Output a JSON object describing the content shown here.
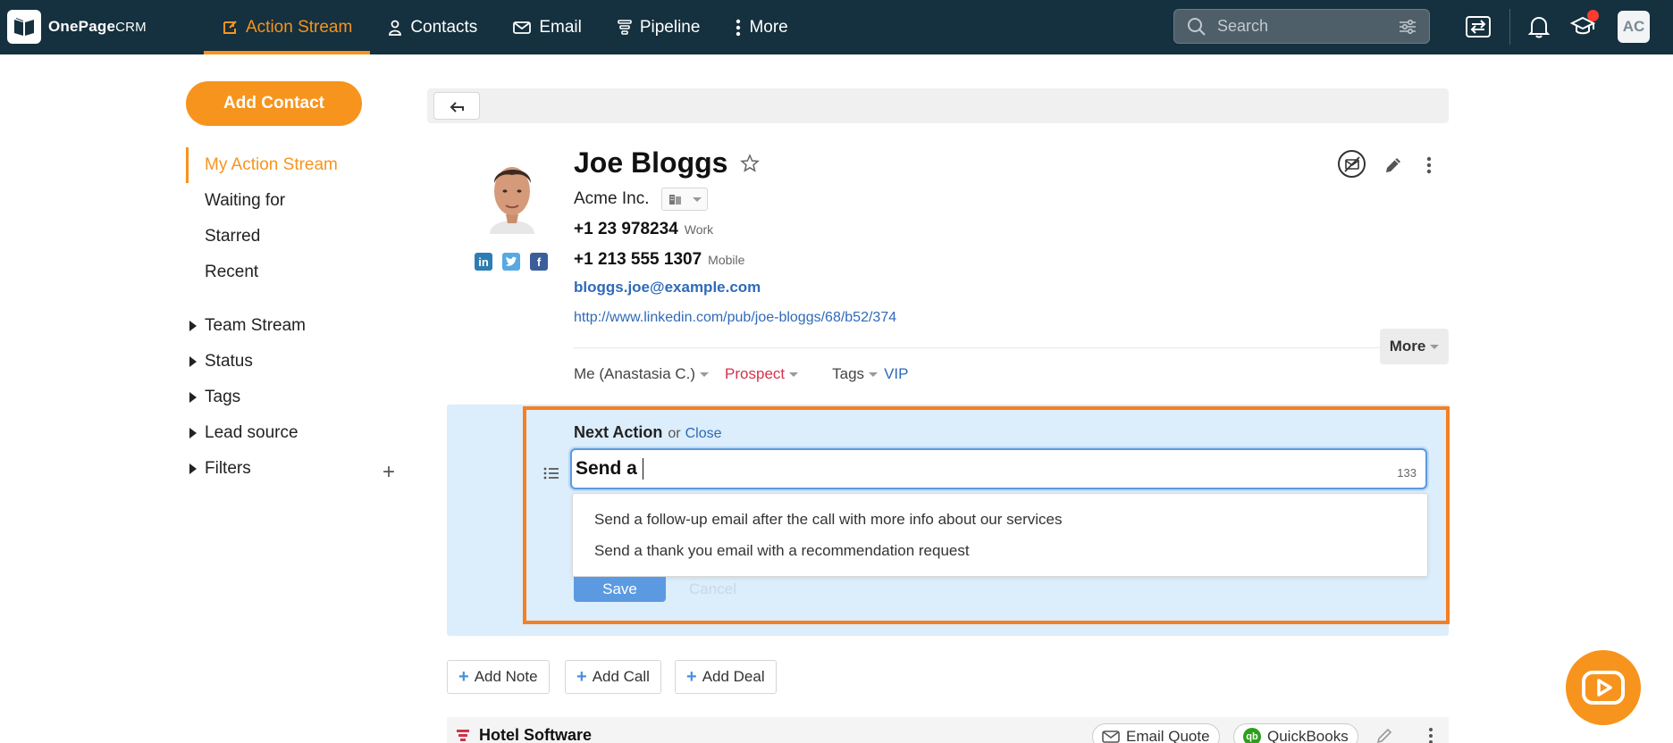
{
  "app": {
    "logo_name": "OnePage",
    "logo_suffix": "CRM"
  },
  "nav": {
    "items": [
      {
        "label": "Action Stream",
        "icon": "action-stream-icon",
        "active": true
      },
      {
        "label": "Contacts",
        "icon": "person-icon"
      },
      {
        "label": "Email",
        "icon": "envelope-icon"
      },
      {
        "label": "Pipeline",
        "icon": "funnel-icon"
      },
      {
        "label": "More",
        "icon": "vertical-dots-icon"
      }
    ],
    "search_placeholder": "Search",
    "avatar_initials": "AC"
  },
  "sidebar": {
    "add_contact": "Add Contact",
    "items": [
      "My Action Stream",
      "Waiting for",
      "Starred",
      "Recent"
    ],
    "groups": [
      "Team Stream",
      "Status",
      "Tags",
      "Lead source",
      "Filters"
    ]
  },
  "contact": {
    "name": "Joe Bloggs",
    "company": "Acme Inc.",
    "phones": [
      {
        "number": "+1 23 978234",
        "type": "Work"
      },
      {
        "number": "+1 213 555 1307",
        "type": "Mobile"
      }
    ],
    "email": "bloggs.joe@example.com",
    "website": "http://www.linkedin.com/pub/joe-bloggs/68/b52/374",
    "more_label": "More",
    "owner": "Me (Anastasia C.)",
    "status": "Prospect",
    "tags_label": "Tags",
    "tag_value": "VIP",
    "colors": {
      "status": "#d2334c",
      "link": "#2f6ab8"
    }
  },
  "next_action": {
    "title": "Next Action",
    "or_text": "or",
    "close_label": "Close",
    "input_value": "Send a",
    "char_count": "133",
    "suggestions": [
      "Send a follow-up email after the call with more info about our services",
      "Send a thank you email with a recommendation request"
    ],
    "save_label": "Save",
    "cancel_label": "Cancel"
  },
  "actions": {
    "add_note": "Add Note",
    "add_call": "Add Call",
    "add_deal": "Add Deal"
  },
  "deal": {
    "title": "Hotel Software",
    "email_quote": "Email Quote",
    "quickbooks": "QuickBooks"
  },
  "accent_color": "#f7941d"
}
